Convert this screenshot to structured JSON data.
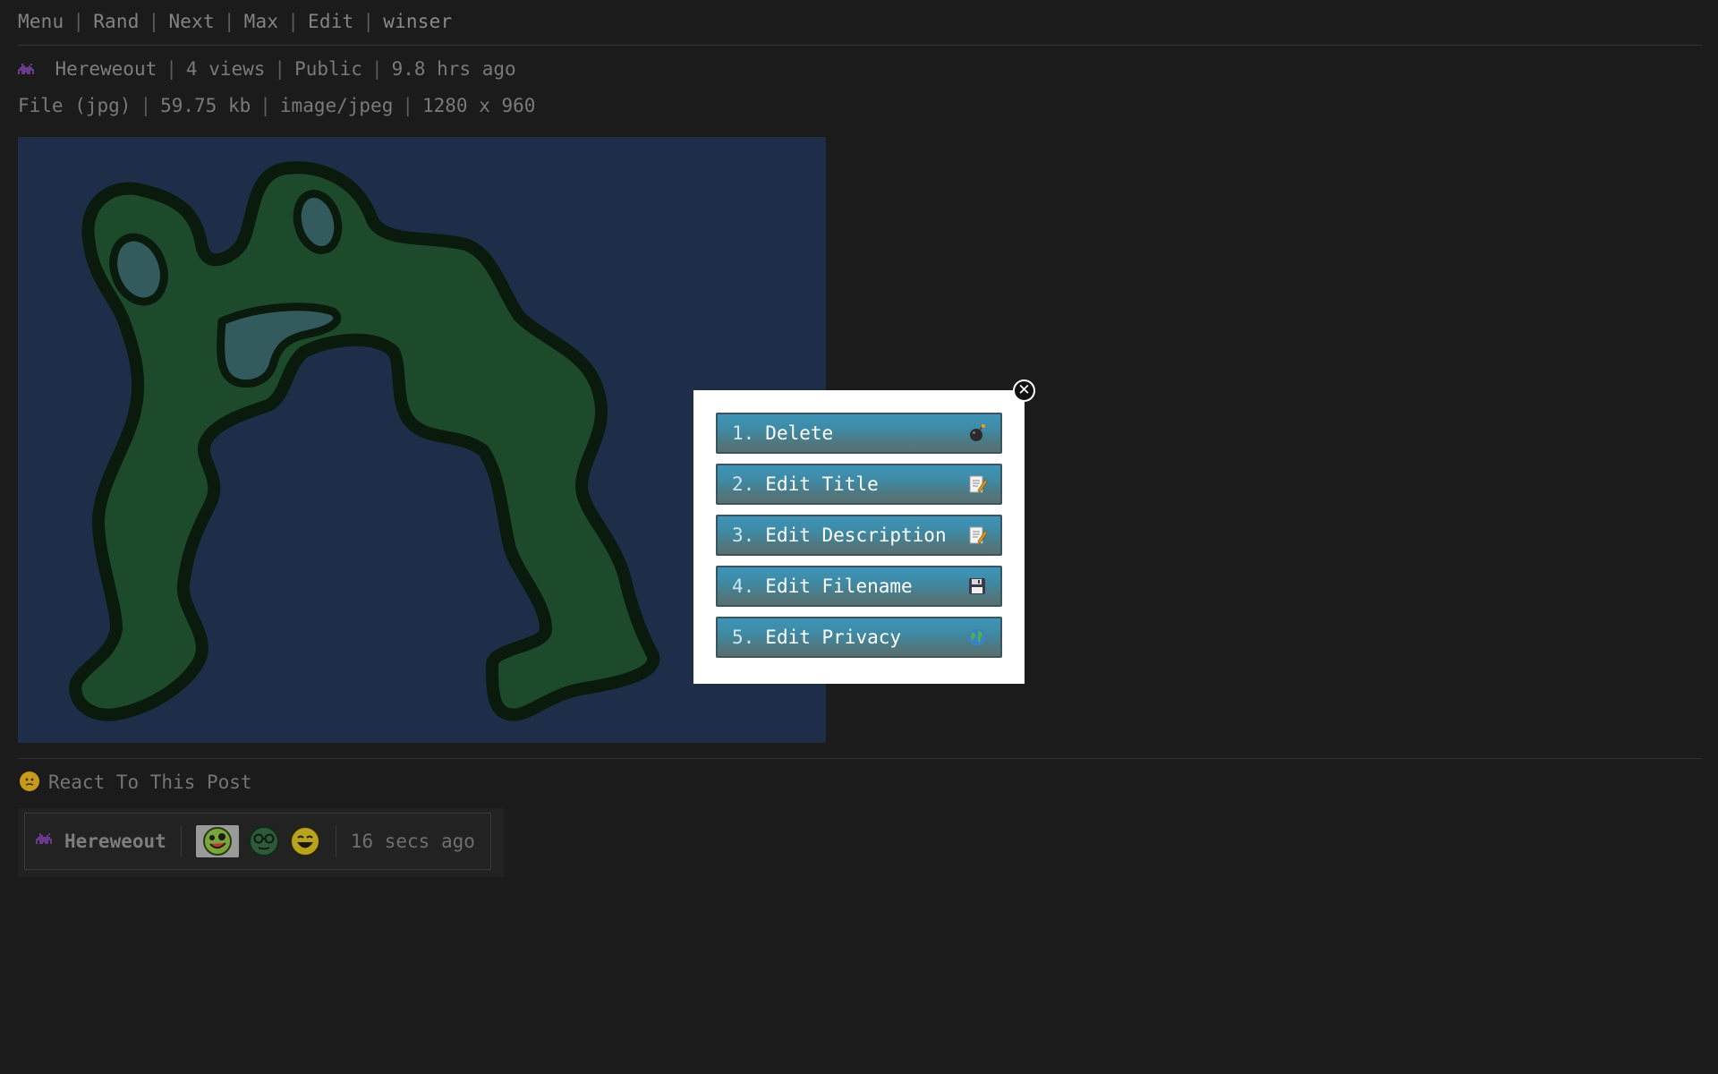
{
  "nav": {
    "menu": "Menu",
    "rand": "Rand",
    "next": "Next",
    "max": "Max",
    "edit": "Edit",
    "user": "winser",
    "separator": "|"
  },
  "post": {
    "author": "Hereweout",
    "views": "4 views",
    "visibility": "Public",
    "posted": "9.8 hrs ago",
    "author_icon": "alien-monster-icon"
  },
  "file": {
    "type": "File (jpg)",
    "size": "59.75 kb",
    "mime": "image/jpeg",
    "dimensions": "1280 x 960"
  },
  "reactions": {
    "title": "React To This Post",
    "title_icon": "thinking-face-icon",
    "entry": {
      "user": "Hereweout",
      "time": "16 secs ago",
      "emojis": [
        "zany-face-icon",
        "nerd-face-icon",
        "grinning-face-icon"
      ]
    }
  },
  "modal": {
    "close_label": "✕",
    "items": [
      {
        "num": "1.",
        "label": "Delete",
        "icon": "bomb-icon"
      },
      {
        "num": "2.",
        "label": "Edit Title",
        "icon": "memo-icon"
      },
      {
        "num": "3.",
        "label": "Edit Description",
        "icon": "memo-icon"
      },
      {
        "num": "4.",
        "label": "Edit Filename",
        "icon": "floppy-disk-icon"
      },
      {
        "num": "5.",
        "label": "Edit Privacy",
        "icon": "globe-icon"
      }
    ]
  },
  "colors": {
    "background": "#1b1b1b",
    "image_bg": "#1e2e48",
    "blob_fill": "#1c4a2a",
    "blob_outline": "#0a1a0c",
    "button_top": "#3e94b8",
    "button_bottom": "#5a6f6f"
  }
}
